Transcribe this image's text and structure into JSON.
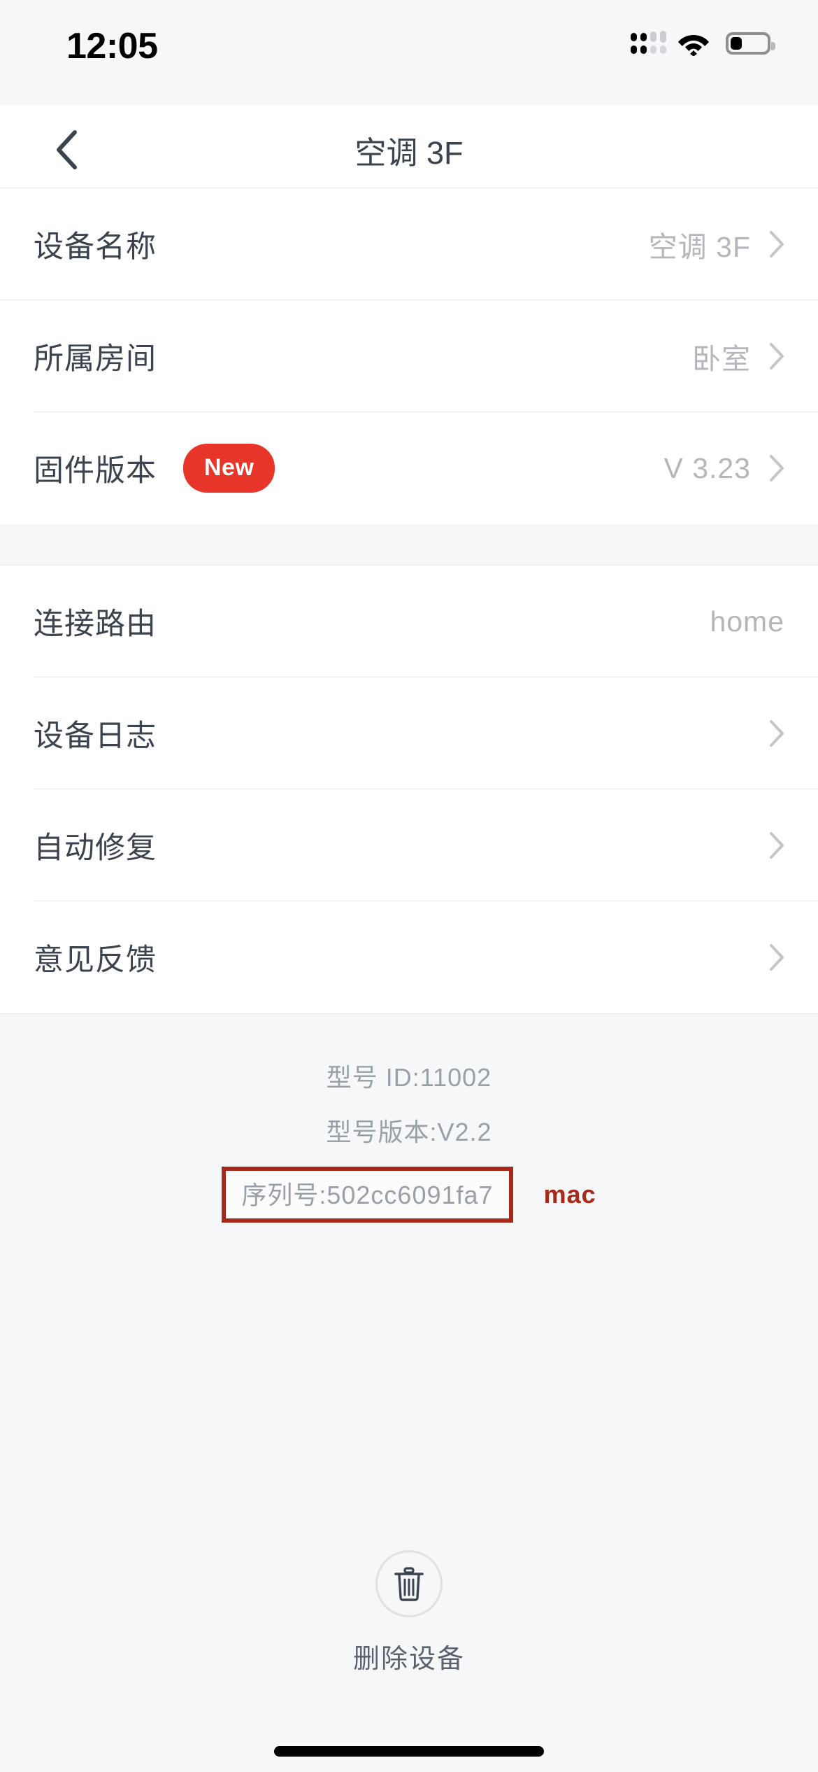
{
  "status_bar": {
    "time": "12:05",
    "signal_icon": "signal-dots-icon",
    "wifi_icon": "wifi-icon",
    "battery_icon": "battery-icon",
    "battery_level_percent": 28
  },
  "nav": {
    "back_icon": "chevron-left-icon",
    "title": "空调 3F"
  },
  "section_one": {
    "rows": [
      {
        "label": "设备名称",
        "value": "空调 3F",
        "chevron": "chevron-right-icon",
        "badge": ""
      },
      {
        "label": "所属房间",
        "value": "卧室",
        "chevron": "chevron-right-icon",
        "badge": ""
      },
      {
        "label": "固件版本",
        "value": "V 3.23",
        "chevron": "chevron-right-icon",
        "badge": "New"
      }
    ]
  },
  "section_two": {
    "rows": [
      {
        "label": "连接路由",
        "value": "home",
        "chevron": ""
      },
      {
        "label": "设备日志",
        "value": "",
        "chevron": "chevron-right-icon"
      },
      {
        "label": "自动修复",
        "value": "",
        "chevron": "chevron-right-icon"
      },
      {
        "label": "意见反馈",
        "value": "",
        "chevron": "chevron-right-icon"
      }
    ]
  },
  "info": {
    "model_id": "型号 ID:11002",
    "model_version": "型号版本:V2.2",
    "serial": "序列号:502cc6091fa7",
    "annotation_label": "mac",
    "annotation_color": "#a8291a"
  },
  "delete": {
    "icon": "trash-icon",
    "label": "删除设备"
  },
  "colors": {
    "badge_red": "#e8352a",
    "label_text": "#3b434e",
    "value_text": "#b3b6bb",
    "page_bg": "#f6f7f9",
    "card_bg": "#ffffff"
  }
}
